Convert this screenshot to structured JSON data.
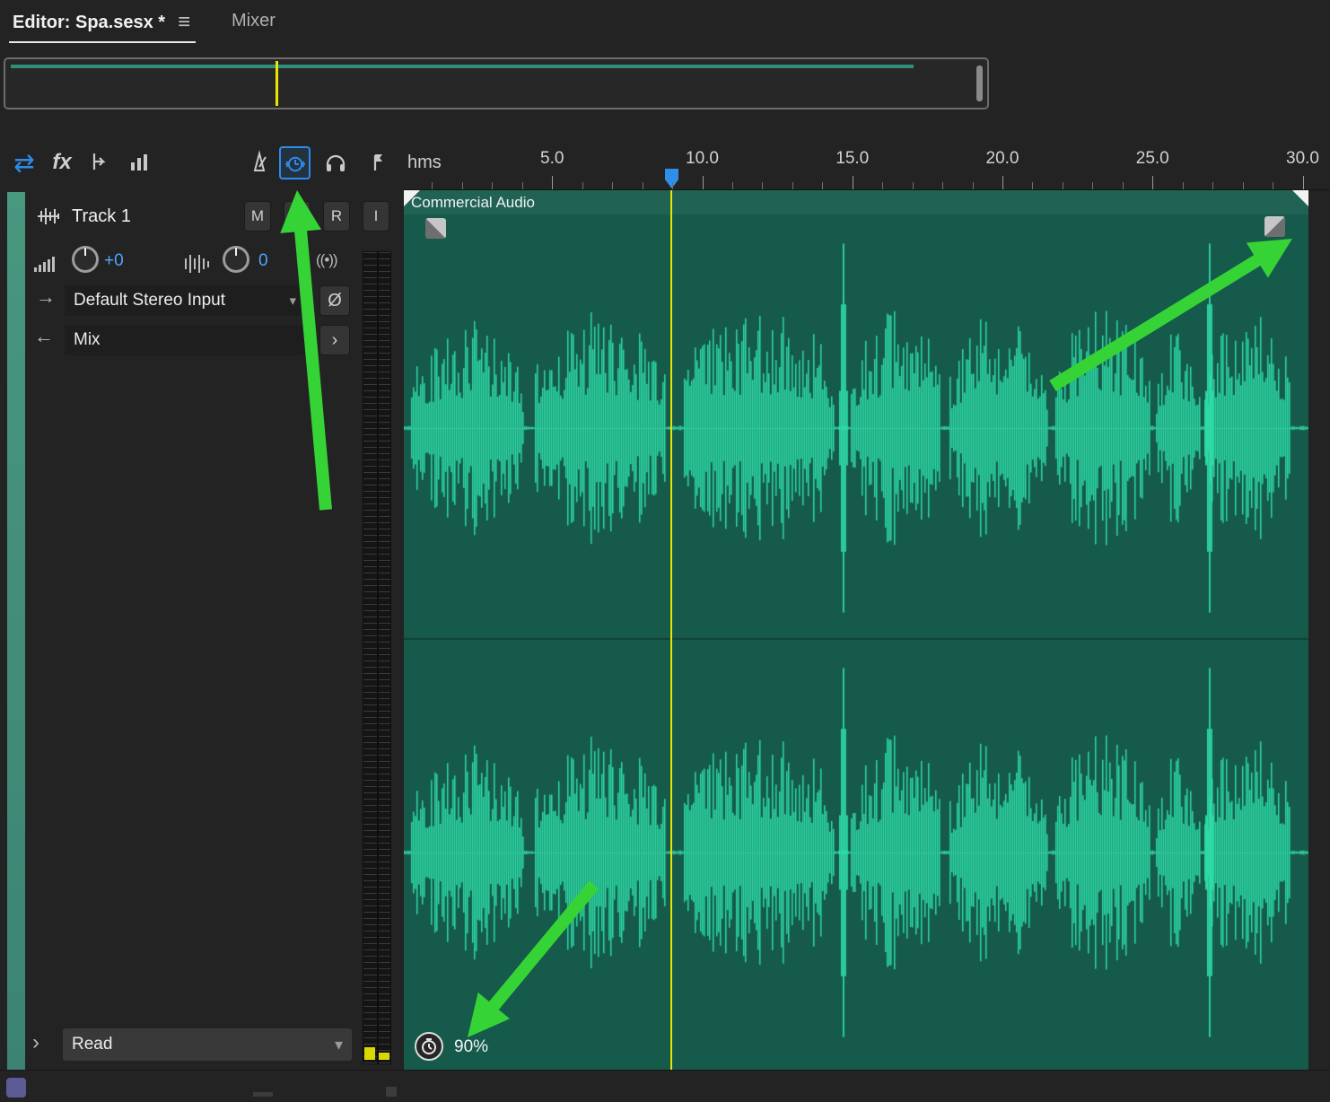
{
  "tabs": {
    "editor_label": "Editor: Spa.sesx *",
    "mixer_label": "Mixer"
  },
  "toolbar": {
    "fx_label": "fx"
  },
  "ruler": {
    "unit_label": "hms",
    "labels": [
      "5.0",
      "10.0",
      "15.0",
      "20.0",
      "25.0",
      "30.0"
    ]
  },
  "track": {
    "name": "Track 1",
    "mute": "M",
    "solo": "S",
    "record": "R",
    "monitor": "I",
    "volume_value": "+0",
    "pan_value": "0",
    "input_label": "Default Stereo Input",
    "bus_label": "Mix",
    "automation_mode": "Read",
    "phase_glyph": "Ø"
  },
  "clip": {
    "title": "Commercial Audio",
    "stretch_percent": "90%"
  },
  "colors": {
    "accent_blue": "#2d8ceb",
    "value_blue": "#4da6ff",
    "waveform": "#2ed9a5",
    "clip_bg": "#155a4b",
    "playhead": "#e8e600",
    "arrow": "#36d336",
    "track_strip": "#3e8a79"
  }
}
